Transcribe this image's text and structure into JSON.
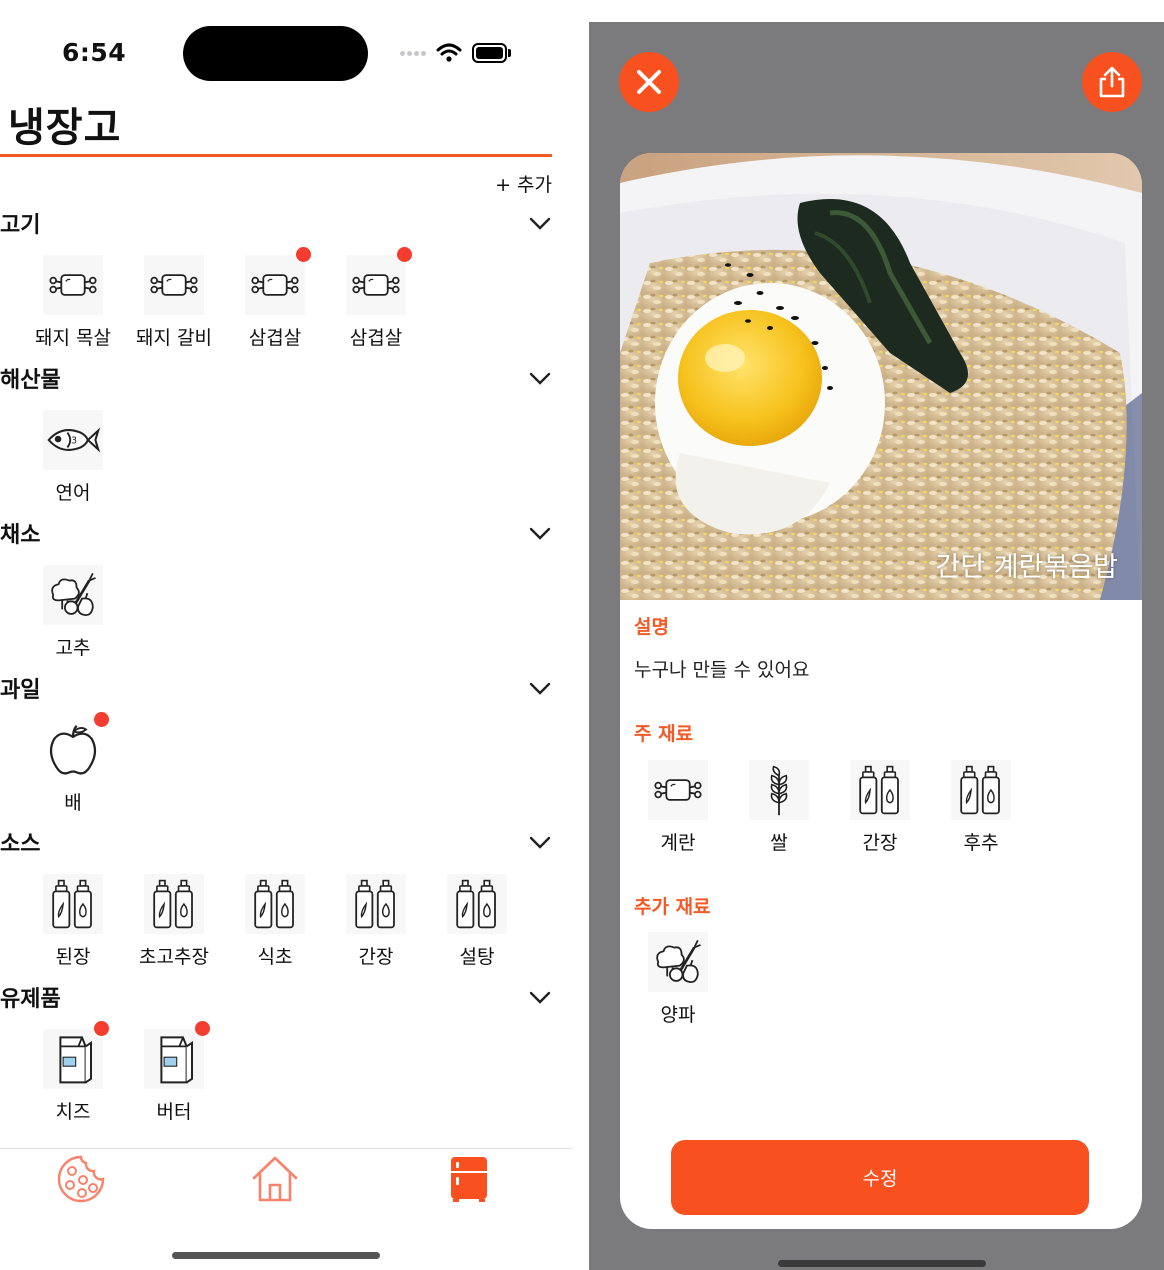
{
  "status_bar": {
    "time": "6:54"
  },
  "fridge": {
    "title": "냉장고",
    "add_label": "+ 추가",
    "categories": [
      {
        "name": "고기",
        "items": [
          {
            "label": "돼지 목살",
            "icon": "meat-icon",
            "alert": false
          },
          {
            "label": "돼지 갈비",
            "icon": "meat-icon",
            "alert": false
          },
          {
            "label": "삼겹살",
            "icon": "meat-icon",
            "alert": true
          },
          {
            "label": "삼겹살",
            "icon": "meat-icon",
            "alert": true
          }
        ]
      },
      {
        "name": "해산물",
        "items": [
          {
            "label": "연어",
            "icon": "fish-icon",
            "alert": false
          }
        ]
      },
      {
        "name": "채소",
        "items": [
          {
            "label": "고추",
            "icon": "vegetable-icon",
            "alert": false
          }
        ]
      },
      {
        "name": "과일",
        "items": [
          {
            "label": "배",
            "icon": "apple-icon",
            "alert": true
          }
        ]
      },
      {
        "name": "소스",
        "items": [
          {
            "label": "된장",
            "icon": "sauce-bottles-icon",
            "alert": false
          },
          {
            "label": "초고추장",
            "icon": "sauce-bottles-icon",
            "alert": false
          },
          {
            "label": "식초",
            "icon": "sauce-bottles-icon",
            "alert": false
          },
          {
            "label": "간장",
            "icon": "sauce-bottles-icon",
            "alert": false
          },
          {
            "label": "설탕",
            "icon": "sauce-bottles-icon",
            "alert": false
          }
        ]
      },
      {
        "name": "유제품",
        "items": [
          {
            "label": "치즈",
            "icon": "milk-carton-icon",
            "alert": true
          },
          {
            "label": "버터",
            "icon": "milk-carton-icon",
            "alert": true
          }
        ]
      }
    ],
    "tabs": [
      {
        "name": "recipes",
        "icon": "cookie-icon",
        "active": false
      },
      {
        "name": "home",
        "icon": "home-icon",
        "active": false
      },
      {
        "name": "fridge",
        "icon": "fridge-icon",
        "active": true
      }
    ]
  },
  "recipe": {
    "title": "간단 계란볶음밥",
    "description_heading": "설명",
    "description": "누구나 만들 수 있어요",
    "main_heading": "주 재료",
    "main_ingredients": [
      {
        "label": "계란",
        "icon": "meat-icon"
      },
      {
        "label": "쌀",
        "icon": "wheat-icon"
      },
      {
        "label": "간장",
        "icon": "sauce-bottles-icon"
      },
      {
        "label": "후추",
        "icon": "sauce-bottles-icon"
      }
    ],
    "extra_heading": "추가 재료",
    "extra_ingredients": [
      {
        "label": "양파",
        "icon": "vegetable-icon"
      }
    ],
    "edit_label": "수정",
    "close_icon": "close-icon",
    "share_icon": "share-icon"
  },
  "colors": {
    "accent": "#f8501f",
    "rule": "#f45a26",
    "badge": "#f43c2f",
    "backdrop": "#7b7a7c"
  }
}
